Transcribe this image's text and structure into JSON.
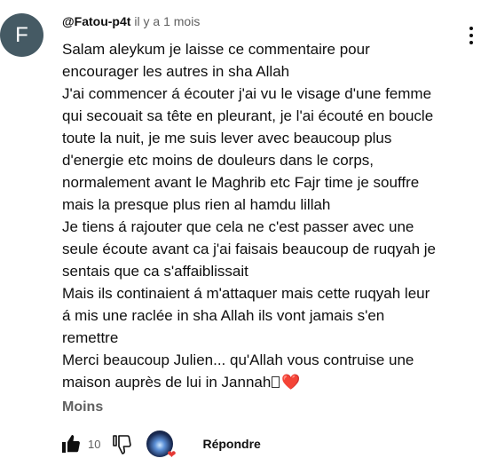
{
  "author": {
    "avatar_letter": "F",
    "handle": "@Fatou-p4t",
    "time": "il y a 1 mois",
    "avatar_color": "#455a64"
  },
  "comment": {
    "lines": [
      "Salam aleykum je laisse ce commentaire pour",
      "encourager les autres in sha Allah",
      "J'ai commencer á écouter j'ai vu le visage d'une femme",
      "qui secouait sa tête en pleurant, je l'ai écouté en boucle",
      "toute la nuit, je me suis lever avec beaucoup plus",
      "d'energie etc moins de douleurs dans le corps,",
      "normalement avant le Maghrib etc Fajr time je souffre",
      "mais la presque plus rien al hamdu lillah",
      "Je tiens á rajouter que cela ne c'est passer avec une",
      "seule écoute avant ca j'ai faisais beaucoup de ruqyah je",
      "sentais que  ca s'affaiblissait",
      "Mais ils continaient á m'attaquer mais cette ruqyah leur",
      "á mis une raclée in sha Allah ils vont jamais s'en",
      "remettre",
      "Merci beaucoup Julien... qu'Allah vous contruise une",
      "maison auprès de lui in Jannah"
    ],
    "heart": "❤️"
  },
  "actions": {
    "collapse_label": "Moins",
    "like_count": "10",
    "reply_label": "Répondre",
    "like_icon": "thumbs-up-filled-icon",
    "dislike_icon": "thumbs-down-outline-icon",
    "creator_heart_icon": "creator-heart-icon",
    "menu_icon": "kebab-menu-icon"
  }
}
